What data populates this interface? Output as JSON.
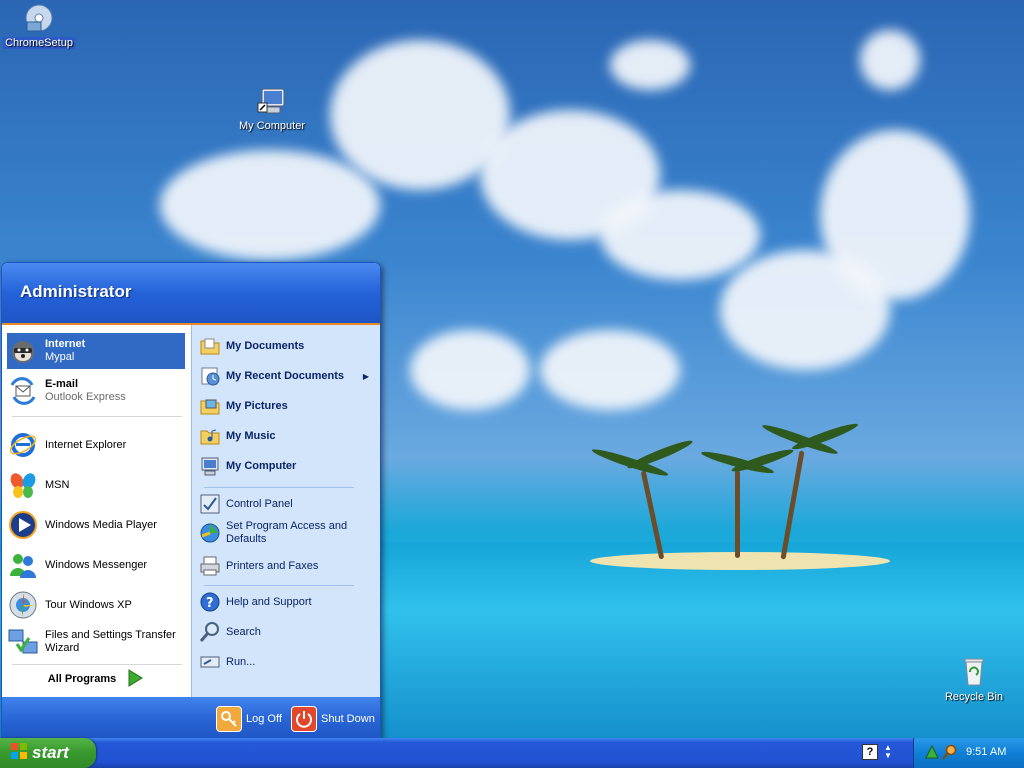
{
  "desktop": {
    "icons": {
      "chromesetup": "ChromeSetup",
      "mycomputer": "My Computer",
      "recyclebin": "Recycle Bin"
    }
  },
  "start_menu": {
    "user": "Administrator",
    "left": {
      "internet": {
        "title": "Internet",
        "sub": "Mypal"
      },
      "email": {
        "title": "E-mail",
        "sub": "Outlook Express"
      },
      "recent": [
        "Internet Explorer",
        "MSN",
        "Windows Media Player",
        "Windows Messenger",
        "Tour Windows XP",
        "Files and Settings Transfer Wizard"
      ],
      "all_programs": "All Programs"
    },
    "right": {
      "my_documents": "My Documents",
      "my_recent_documents": "My Recent Documents",
      "my_pictures": "My Pictures",
      "my_music": "My Music",
      "my_computer": "My Computer",
      "control_panel": "Control Panel",
      "set_program_access": "Set Program Access and Defaults",
      "printers_faxes": "Printers and Faxes",
      "help_support": "Help and Support",
      "search": "Search",
      "run": "Run..."
    },
    "footer": {
      "log_off": "Log Off",
      "shut_down": "Shut Down"
    }
  },
  "taskbar": {
    "start_label": "start",
    "clock": "9:51 AM"
  },
  "colors": {
    "taskbar_blue": "#2252d3",
    "start_green": "#3a9a2f",
    "selection_blue": "#316ac5",
    "right_pane": "#d3e5fa"
  }
}
